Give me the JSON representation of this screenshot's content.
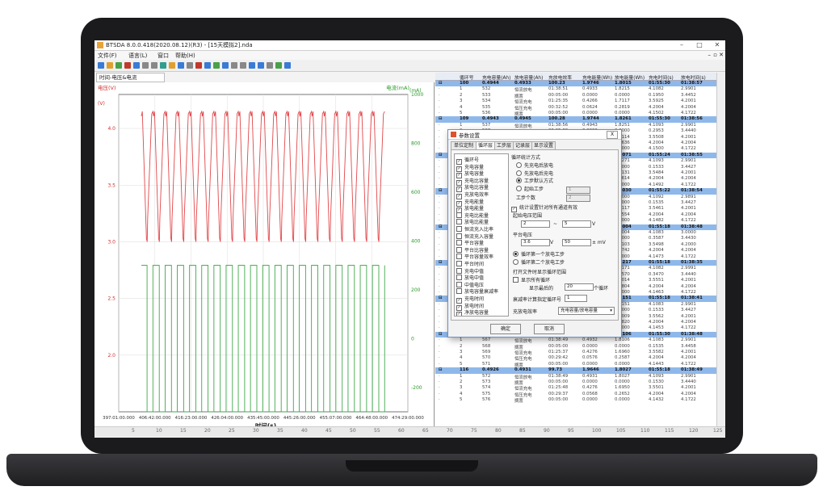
{
  "window": {
    "title": "BTSDA 8.0.0.418(2020.08.12)(R3) - [15天模拟2].nda"
  },
  "menu": [
    "文件(F)",
    "语言(L)",
    "窗口",
    "帮助(H)"
  ],
  "chart_tab": "时间-电压&电流",
  "chart_data": {
    "type": "line",
    "title": "",
    "legend_left": "电压(V)",
    "legend_right": "电流(mA)",
    "xlabel": "时间(s)",
    "left_axis_unit": "(V)",
    "right_axis_unit": "(mA)",
    "y_left_ticks": [
      "4.0",
      "3.5",
      "3.0",
      "2.5",
      "2.0"
    ],
    "y_right_ticks": [
      "1000",
      "800",
      "600",
      "400",
      "200",
      "0",
      "-200"
    ],
    "x_ticks": [
      "397:01:00.000",
      "406:42:00.000",
      "416:23:00.000",
      "426:04:00.000",
      "435:45:00.000",
      "445:26:00.000",
      "455:07:00.000",
      "464:48:00.000",
      "474:29:00.000"
    ],
    "ylim_left": [
      1.5,
      4.3
    ],
    "ylim_right": [
      -300,
      1000
    ],
    "grid": true,
    "cycles": 20,
    "voltage_series": {
      "name": "电压",
      "high": 4.15,
      "low": 3.0,
      "color": "#e2474a"
    },
    "current_series": {
      "name": "电流",
      "high": 300,
      "low": -300,
      "color": "#3fa84a"
    }
  },
  "scrollbar_labels": [
    "5",
    "10",
    "15",
    "20",
    "25",
    "30",
    "35",
    "40",
    "45",
    "50",
    "55",
    "60",
    "65",
    "70",
    "75",
    "80",
    "85",
    "90",
    "95",
    "100",
    "105",
    "110",
    "115",
    "120",
    "125"
  ],
  "table": {
    "headers": [
      "循环号",
      "充电容量(Ah)",
      "放电容量(Ah)",
      "充放电效率",
      "充电能量(Wh)",
      "放电能量(Wh)",
      "充电时间(s)",
      "放电时间(s)"
    ],
    "rows": [
      {
        "cycle": true,
        "c": [
          "100",
          "0.4944",
          "0.4933",
          "100.23",
          "1.9746",
          "1.8015",
          "01:55:30",
          "01:38:57"
        ]
      },
      {
        "cycle": false,
        "c": [
          "1",
          "532",
          "恒流放电",
          "01:38:51",
          "0.4933",
          "1.8215",
          "4.1082",
          "2.9901"
        ]
      },
      {
        "cycle": false,
        "c": [
          "2",
          "533",
          "搁置",
          "00:05:00",
          "0.0000",
          "0.0000",
          "0.1950",
          "3.4452"
        ]
      },
      {
        "cycle": false,
        "c": [
          "3",
          "534",
          "恒流充电",
          "01:25:35",
          "0.4266",
          "1.7117",
          "3.5925",
          "4.2001"
        ]
      },
      {
        "cycle": false,
        "c": [
          "4",
          "535",
          "恒压充电",
          "00:32:52",
          "0.0624",
          "0.2819",
          "4.2004",
          "4.2004"
        ]
      },
      {
        "cycle": false,
        "c": [
          "5",
          "536",
          "搁置",
          "00:05:00",
          "0.0000",
          "0.0000",
          "4.1502",
          "4.1722"
        ]
      },
      {
        "cycle": true,
        "c": [
          "109",
          "0.4943",
          "0.4945",
          "100.28",
          "1.9744",
          "1.8261",
          "01:55:30",
          "01:38:56"
        ]
      },
      {
        "cycle": false,
        "c": [
          "1",
          "537",
          "恒流放电",
          "01:38:56",
          "0.4943",
          "1.8251",
          "4.1093",
          "2.9901"
        ]
      },
      {
        "cycle": false,
        "c": [
          "2",
          "538",
          "搁置",
          "00:05:00",
          "0.0000",
          "0.0000",
          "0.2953",
          "3.4440"
        ]
      },
      {
        "cycle": false,
        "c": [
          "3",
          "539",
          "恒流充电",
          "01:25:48",
          "0.4356",
          "1.7114",
          "3.5508",
          "4.2001"
        ]
      },
      {
        "cycle": false,
        "c": [
          "4",
          "540",
          "恒压充电",
          "00:29:54",
          "0.0591",
          "0.2636",
          "4.2004",
          "4.2004"
        ]
      },
      {
        "cycle": false,
        "c": [
          "5",
          "541",
          "搁置",
          "00:05:00",
          "0.0000",
          "0.0000",
          "4.1500",
          "4.1722"
        ]
      },
      {
        "cycle": true,
        "c": [
          "111",
          "0.4931",
          "0.4938",
          "100.15",
          "1.9744",
          "1.8071",
          "01:55:24",
          "01:38:55"
        ]
      },
      {
        "cycle": false,
        "c": [
          "1",
          "542",
          "恒流放电",
          "01:38:55",
          "0.4938",
          "1.8271",
          "4.1093",
          "2.9901"
        ]
      },
      {
        "cycle": false,
        "c": [
          "2",
          "543",
          "搁置",
          "00:05:00",
          "0.0000",
          "0.0000",
          "0.1533",
          "3.4427"
        ]
      },
      {
        "cycle": false,
        "c": [
          "3",
          "544",
          "恒流充电",
          "01:25:47",
          "0.4291",
          "1.7131",
          "3.5484",
          "4.2001"
        ]
      },
      {
        "cycle": false,
        "c": [
          "4",
          "545",
          "恒压充电",
          "00:29:37",
          "0.0580",
          "0.2614",
          "4.2004",
          "4.2004"
        ]
      },
      {
        "cycle": false,
        "c": [
          "5",
          "546",
          "搁置",
          "00:05:00",
          "0.0000",
          "0.0000",
          "4.1492",
          "4.1722"
        ]
      },
      {
        "cycle": true,
        "c": [
          "112",
          "0.4925",
          "0.4935",
          "100.09",
          "1.9740",
          "1.8030",
          "01:55:22",
          "01:38:54"
        ]
      },
      {
        "cycle": false,
        "c": [
          "1",
          "547",
          "恒流放电",
          "01:38:54",
          "0.4935",
          "1.8000",
          "4.1092",
          "2.9891"
        ]
      },
      {
        "cycle": false,
        "c": [
          "2",
          "548",
          "搁置",
          "00:05:00",
          "0.0000",
          "0.0000",
          "0.1535",
          "3.4427"
        ]
      },
      {
        "cycle": false,
        "c": [
          "3",
          "549",
          "恒流充电",
          "01:25:45",
          "0.4290",
          "1.7117",
          "3.5461",
          "4.2001"
        ]
      },
      {
        "cycle": false,
        "c": [
          "4",
          "550",
          "恒压充电",
          "00:29:37",
          "0.0578",
          "0.2554",
          "4.2004",
          "4.2004"
        ]
      },
      {
        "cycle": false,
        "c": [
          "5",
          "551",
          "搁置",
          "00:05:00",
          "0.0000",
          "0.0000",
          "4.1482",
          "4.1722"
        ]
      },
      {
        "cycle": true,
        "c": [
          "113",
          "0.4920",
          "0.4929",
          "100.00",
          "1.9739",
          "1.8004",
          "01:55:18",
          "01:38:48"
        ]
      },
      {
        "cycle": false,
        "c": [
          "1",
          "552",
          "恒流放电",
          "01:38:48",
          "0.4929",
          "1.8004",
          "4.1083",
          "3.0000"
        ]
      },
      {
        "cycle": false,
        "c": [
          "2",
          "553",
          "搁置",
          "00:05:00",
          "0.0000",
          "0.0000",
          "0.3587",
          "3.4430"
        ]
      },
      {
        "cycle": false,
        "c": [
          "3",
          "554",
          "恒流充电",
          "01:25:40",
          "0.4286",
          "1.7103",
          "3.5498",
          "4.2000"
        ]
      },
      {
        "cycle": false,
        "c": [
          "4",
          "555",
          "恒压充电",
          "00:29:38",
          "0.0577",
          "0.2742",
          "4.2004",
          "4.2004"
        ]
      },
      {
        "cycle": false,
        "c": [
          "5",
          "556",
          "搁置",
          "00:05:00",
          "0.0000",
          "0.0000",
          "4.1473",
          "4.1722"
        ]
      },
      {
        "cycle": true,
        "c": [
          "114",
          "0.4917",
          "0.4923",
          "100.10",
          "1.9737",
          "1.8217",
          "01:55:18",
          "01:38:35"
        ]
      },
      {
        "cycle": false,
        "c": [
          "1",
          "557",
          "恒流放电",
          "01:38:35",
          "0.4923",
          "1.8171",
          "4.1082",
          "2.9991"
        ]
      },
      {
        "cycle": false,
        "c": [
          "2",
          "558",
          "搁置",
          "00:05:00",
          "0.0000",
          "0.1570",
          "0.3470",
          "3.4440"
        ]
      },
      {
        "cycle": false,
        "c": [
          "3",
          "559",
          "恒流充电",
          "01:25:55",
          "0.4270",
          "1.7014",
          "3.5551",
          "4.2001"
        ]
      },
      {
        "cycle": false,
        "c": [
          "4",
          "560",
          "恒压充电",
          "00:29:37",
          "0.0577",
          "0.2804",
          "4.2004",
          "4.2004"
        ]
      },
      {
        "cycle": false,
        "c": [
          "5",
          "561",
          "搁置",
          "00:05:00",
          "0.0000",
          "0.0000",
          "4.1463",
          "4.1722"
        ]
      },
      {
        "cycle": true,
        "c": [
          "115",
          "0.4915",
          "0.4918",
          "100.15",
          "1.9734",
          "1.8151",
          "01:55:18",
          "01:38:41"
        ]
      },
      {
        "cycle": false,
        "c": [
          "1",
          "562",
          "恒流放电",
          "01:38:41",
          "0.4918",
          "1.8151",
          "4.1083",
          "2.9901"
        ]
      },
      {
        "cycle": false,
        "c": [
          "2",
          "563",
          "搁置",
          "00:05:00",
          "0.0000",
          "0.0000",
          "0.1533",
          "3.4427"
        ]
      },
      {
        "cycle": false,
        "c": [
          "3",
          "564",
          "恒流充电",
          "01:25:55",
          "0.4270",
          "1.7009",
          "3.5562",
          "4.2001"
        ]
      },
      {
        "cycle": false,
        "c": [
          "4",
          "565",
          "恒压充电",
          "00:29:36",
          "0.0576",
          "0.2820",
          "4.2004",
          "4.2004"
        ]
      },
      {
        "cycle": false,
        "c": [
          "5",
          "566",
          "搁置",
          "00:05:00",
          "0.0000",
          "0.0000",
          "4.1453",
          "4.1722"
        ]
      },
      {
        "cycle": true,
        "c": [
          "115",
          "0.4931",
          "0.4932",
          "100.16",
          "1.9660",
          "1.8106",
          "01:55:30",
          "01:38:48"
        ]
      },
      {
        "cycle": false,
        "c": [
          "1",
          "567",
          "恒流放电",
          "01:38:49",
          "0.4932",
          "1.8106",
          "4.1083",
          "2.9901"
        ]
      },
      {
        "cycle": false,
        "c": [
          "2",
          "568",
          "搁置",
          "00:05:00",
          "0.0000",
          "0.0000",
          "0.1535",
          "3.4458"
        ]
      },
      {
        "cycle": false,
        "c": [
          "3",
          "569",
          "恒流充电",
          "01:25:37",
          "0.4276",
          "1.6960",
          "3.5582",
          "4.2001"
        ]
      },
      {
        "cycle": false,
        "c": [
          "4",
          "570",
          "恒压充电",
          "00:29:42",
          "0.0576",
          "0.2587",
          "4.2004",
          "4.2004"
        ]
      },
      {
        "cycle": false,
        "c": [
          "5",
          "571",
          "搁置",
          "00:05:00",
          "0.0000",
          "0.0000",
          "4.1443",
          "4.1722"
        ]
      },
      {
        "cycle": true,
        "c": [
          "116",
          "0.4926",
          "0.4931",
          "99.73",
          "1.9646",
          "1.8027",
          "01:55:18",
          "01:38:49"
        ]
      },
      {
        "cycle": false,
        "c": [
          "1",
          "572",
          "恒流放电",
          "01:38:49",
          "0.4931",
          "1.8027",
          "4.1093",
          "2.9901"
        ]
      },
      {
        "cycle": false,
        "c": [
          "2",
          "573",
          "搁置",
          "00:05:00",
          "0.0000",
          "0.0000",
          "0.1530",
          "3.4440"
        ]
      },
      {
        "cycle": false,
        "c": [
          "3",
          "574",
          "恒流充电",
          "01:25:48",
          "0.4276",
          "1.6950",
          "3.5501",
          "4.2001"
        ]
      },
      {
        "cycle": false,
        "c": [
          "4",
          "575",
          "恒压充电",
          "00:29:37",
          "0.0568",
          "0.2652",
          "4.2004",
          "4.2004"
        ]
      },
      {
        "cycle": false,
        "c": [
          "5",
          "576",
          "搁置",
          "00:05:00",
          "0.0000",
          "0.0000",
          "4.1432",
          "4.1722"
        ]
      }
    ]
  },
  "dialog": {
    "title": "参数设置",
    "tabs": [
      "单位定制",
      "循环层",
      "工步层",
      "记录层",
      "显示设置"
    ],
    "active_tab": 1,
    "close_label": "X",
    "checklist": [
      {
        "label": "循环号",
        "checked": true
      },
      {
        "label": "充电容量",
        "checked": true
      },
      {
        "label": "放电容量",
        "checked": true
      },
      {
        "label": "充电比容量",
        "checked": true
      },
      {
        "label": "放电比容量",
        "checked": true
      },
      {
        "label": "充放电效率",
        "checked": true
      },
      {
        "label": "充电能量",
        "checked": true
      },
      {
        "label": "放电能量",
        "checked": true
      },
      {
        "label": "充电比能量",
        "checked": false
      },
      {
        "label": "放电比能量",
        "checked": false
      },
      {
        "label": "恒流充入比率",
        "checked": false
      },
      {
        "label": "恒流充入容量",
        "checked": false
      },
      {
        "label": "平台容量",
        "checked": false
      },
      {
        "label": "平台比容量",
        "checked": false
      },
      {
        "label": "平台容量效率",
        "checked": false
      },
      {
        "label": "平台时间",
        "checked": false
      },
      {
        "label": "充电中值",
        "checked": false
      },
      {
        "label": "放电中值",
        "checked": false
      },
      {
        "label": "中值电压",
        "checked": false
      },
      {
        "label": "放电容量衰减率",
        "checked": false
      },
      {
        "label": "充电时间",
        "checked": true
      },
      {
        "label": "放电时间",
        "checked": true
      },
      {
        "label": "净放电容量",
        "checked": true
      }
    ],
    "stat_mode_label": "循环统计方式",
    "stat_modes": [
      "先充电后放电",
      "先放电后充电",
      "工步默认方式",
      "起始工步"
    ],
    "stat_mode_selected": 2,
    "step_count_label": "工步个数",
    "start_step_value": "1",
    "step_count_value": "2",
    "apply_all_label": "统计设置针对所有通道有效",
    "voltage_range_label": "起始电压范围",
    "voltage_min": "2",
    "voltage_max": "5",
    "unit_v": "V",
    "tilde": "~",
    "plateau_label": "平台电压",
    "plateau_v": "3.6",
    "plateau_tol": "50",
    "unit_mv": "± mV",
    "discharge_steps": [
      "循环第一个放电工步",
      "循环第二个放电工步"
    ],
    "discharge_step_selected": 0,
    "open_file_label": "打开文件时显示循环范围",
    "show_all_label": "显示所有循环",
    "show_recent_label": "显示最后的",
    "show_recent_value": "20",
    "cycles_unit": "个循环",
    "decay_label": "衰减率计算指定循环号",
    "decay_value": "1",
    "efficiency_label": "充放电效率",
    "efficiency_option": "充电容量/放电容量",
    "ok_label": "确定",
    "cancel_label": "取消"
  }
}
